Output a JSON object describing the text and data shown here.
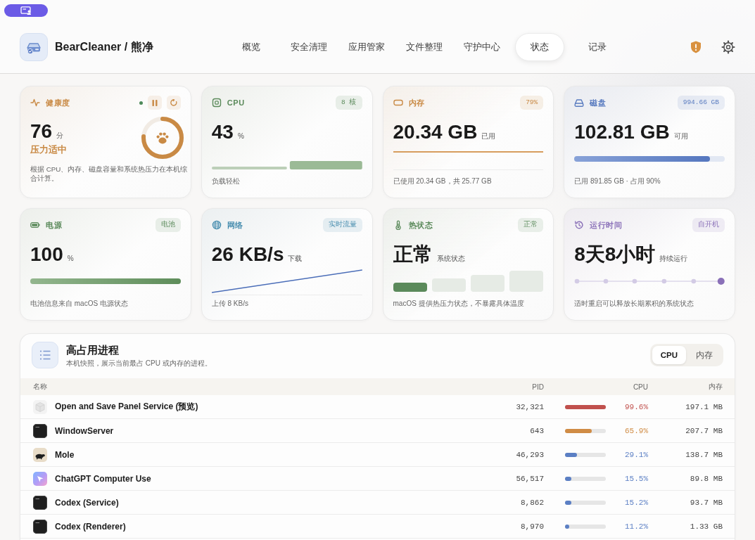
{
  "app": {
    "title": "BearCleaner / 熊净"
  },
  "nav": [
    {
      "label": "概览",
      "selected": false
    },
    {
      "label": "安全清理",
      "selected": false
    },
    {
      "label": "应用管家",
      "selected": false
    },
    {
      "label": "文件整理",
      "selected": false
    },
    {
      "label": "守护中心",
      "selected": false
    },
    {
      "label": "状态",
      "selected": true
    },
    {
      "label": "记录",
      "selected": false
    }
  ],
  "cards": [
    {
      "kind": "health",
      "color": "#c98a45",
      "title": "健康度",
      "value": "76",
      "unit": "分",
      "status": "压力适中",
      "level": 0.76,
      "note": "根据 CPU、内存、磁盘容量和系统热压力在本机综合计算。"
    },
    {
      "kind": "cpu",
      "color": "#5b8a5b",
      "title": "CPU",
      "badge": "8 核",
      "value": "43",
      "unit": "%",
      "note": "负载轻松"
    },
    {
      "kind": "memory",
      "color": "#c98a45",
      "title": "内存",
      "badge": "79%",
      "value": "20.34 GB",
      "unit": "已用",
      "note": "已使用 20.34 GB，共 25.77 GB"
    },
    {
      "kind": "disk",
      "color": "#5a7cc0",
      "title": "磁盘",
      "badge": "994.66 GB",
      "value": "102.81 GB",
      "unit": "可用",
      "level": 0.9,
      "note": "已用 891.85 GB · 占用 90%"
    },
    {
      "kind": "power",
      "color": "#5b8a5b",
      "title": "电源",
      "badge": "电池",
      "value": "100",
      "unit": "%",
      "level": 1,
      "note": "电池信息来自 macOS 电源状态"
    },
    {
      "kind": "network",
      "color": "#4a8fb0",
      "title": "网络",
      "badge": "实时流量",
      "value": "26 KB/s",
      "unit": "下载",
      "note": "上传 8 KB/s"
    },
    {
      "kind": "thermal",
      "color": "#5b8a5b",
      "title": "热状态",
      "badge": "正常",
      "value": "正常",
      "unit": "系统状态",
      "level": 0.25,
      "note": "macOS 提供热压力状态，不暴露具体温度"
    },
    {
      "kind": "uptime",
      "color": "#8a70b8",
      "title": "运行时间",
      "badge": "自开机",
      "value": "8天8小时",
      "unit": "持续运行",
      "note": "适时重启可以释放长期累积的系统状态"
    }
  ],
  "processes": {
    "title": "高占用进程",
    "subtitle": "本机快照，展示当前最占 CPU 或内存的进程。",
    "sort_tabs": [
      {
        "label": "CPU",
        "selected": true
      },
      {
        "label": "内存",
        "selected": false
      }
    ],
    "columns": [
      "名称",
      "PID",
      "CPU",
      "内存"
    ],
    "rows": [
      {
        "kind": "cube",
        "name": "Open and Save Panel Service (预览)",
        "pid": "32,321",
        "level": 0.996,
        "color": "#c0504d",
        "cpu": "99.6%",
        "memory": "197.1 MB"
      },
      {
        "kind": "terminal",
        "name": "WindowServer",
        "pid": "643",
        "level": 0.659,
        "color": "#d08c45",
        "cpu": "65.9%",
        "memory": "207.7 MB"
      },
      {
        "kind": "animal",
        "name": "Mole",
        "pid": "46,293",
        "level": 0.291,
        "color": "#5b7fc4",
        "cpu": "29.1%",
        "memory": "138.7 MB"
      },
      {
        "kind": "gradient",
        "name": "ChatGPT Computer Use",
        "pid": "56,517",
        "level": 0.155,
        "color": "#5b7fc4",
        "cpu": "15.5%",
        "memory": "89.8 MB"
      },
      {
        "kind": "terminal",
        "name": "Codex (Service)",
        "pid": "8,862",
        "level": 0.152,
        "color": "#5b7fc4",
        "cpu": "15.2%",
        "memory": "93.7 MB"
      },
      {
        "kind": "terminal",
        "name": "Codex (Renderer)",
        "pid": "8,970",
        "level": 0.112,
        "color": "#5b7fc4",
        "cpu": "11.2%",
        "memory": "1.33 GB"
      }
    ]
  }
}
